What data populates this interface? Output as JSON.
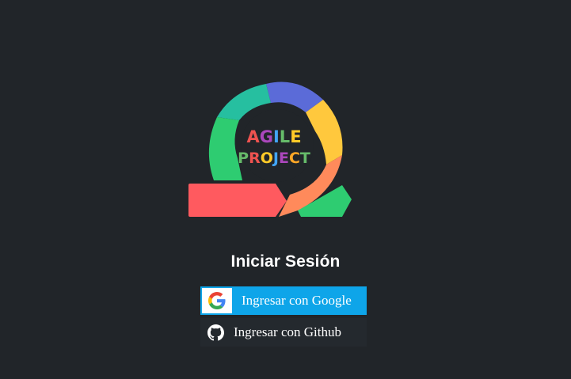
{
  "logo": {
    "line1": [
      "A",
      "G",
      "I",
      "L",
      "E"
    ],
    "line2": [
      "P",
      "R",
      "O",
      "J",
      "E",
      "C",
      "T"
    ],
    "line1_colors": [
      "#ef5350",
      "#ab47bc",
      "#42a5f5",
      "#66bb6a",
      "#ffca28"
    ],
    "line2_colors": [
      "#66bb6a",
      "#ef5350",
      "#ffca28",
      "#42a5f5",
      "#ab47bc",
      "#ffa726",
      "#66bb6a"
    ]
  },
  "login": {
    "title": "Iniciar Sesión",
    "google_label": "Ingresar con Google",
    "github_label": "Ingresar con Github"
  },
  "icons": {
    "google": "google-icon",
    "github": "github-icon"
  },
  "colors": {
    "background": "#212529",
    "google_button": "#0ea5e9",
    "github_button": "#24292e"
  }
}
